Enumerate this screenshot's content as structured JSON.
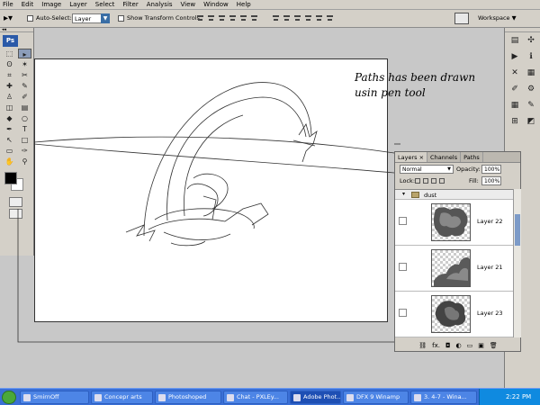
{
  "menu": [
    "File",
    "Edit",
    "Image",
    "Layer",
    "Select",
    "Filter",
    "Analysis",
    "View",
    "Window",
    "Help"
  ],
  "options": {
    "auto_select_label": "Auto-Select:",
    "auto_select_value": "Layer",
    "show_transform_label": "Show Transform Controls",
    "workspace_label": "Workspace ▼"
  },
  "tools": {
    "logo": "Ps",
    "icons": [
      "marquee-icon",
      "move-icon",
      "lasso-icon",
      "magic-wand-icon",
      "crop-icon",
      "slice-icon",
      "healing-brush-icon",
      "brush-icon",
      "clone-stamp-icon",
      "history-brush-icon",
      "eraser-icon",
      "gradient-icon",
      "blur-icon",
      "dodge-icon",
      "pen-icon",
      "type-icon",
      "path-selection-icon",
      "shape-icon",
      "notes-icon",
      "eyedropper-icon",
      "hand-icon",
      "zoom-icon"
    ],
    "glyphs": [
      "⬚",
      "▸",
      "ʘ",
      "✶",
      "⌗",
      "✂",
      "✚",
      "✎",
      "♙",
      "✐",
      "◫",
      "▤",
      "◆",
      "○",
      "✒",
      "T",
      "↖",
      "□",
      "▭",
      "✑",
      "✋",
      "⚲"
    ],
    "fg_color": "#000000",
    "bg_color": "#ffffff"
  },
  "canvas": {
    "note_text": "Paths has been drawn\nusin pen tool"
  },
  "layers_panel": {
    "tabs": [
      "Layers ×",
      "Channels",
      "Paths"
    ],
    "blend_mode": "Normal",
    "opacity_label": "Opacity:",
    "opacity_value": "100%",
    "lock_label": "Lock:",
    "fill_label": "Fill:",
    "fill_value": "100%",
    "group_name": "dust",
    "layers": [
      "Layer 22",
      "Layer 21",
      "Layer 23"
    ],
    "footer_icons": [
      "link-icon",
      "fx-icon",
      "mask-icon",
      "adjustment-icon",
      "new-group-icon",
      "new-layer-icon",
      "trash-icon"
    ],
    "footer_glyphs": [
      "⛓",
      "fx.",
      "◘",
      "◐",
      "▭",
      "▣",
      "🗑"
    ]
  },
  "dock": {
    "icons": [
      "navigator-icon",
      "histogram-icon",
      "info-icon",
      "color-icon",
      "swatches-icon",
      "styles-icon",
      "history-icon",
      "actions-icon",
      "tools-icon",
      "brushes-icon",
      "clone-icon",
      "layer-comps-icon"
    ],
    "glyphs": [
      "▤",
      "✣",
      "▶",
      "ℹ",
      "✕",
      "▦",
      "✐",
      "⚙",
      "▦",
      "✎",
      "⊞",
      "◩"
    ]
  },
  "taskbar": {
    "tasks": [
      "SmirnOff",
      "Concepr arts",
      "Photoshoped",
      "Chat - PXLEy...",
      "Adobe Phot...",
      "DFX 9 Winamp",
      "3. 4-7 - Wina..."
    ],
    "clock": "2:22 PM"
  }
}
